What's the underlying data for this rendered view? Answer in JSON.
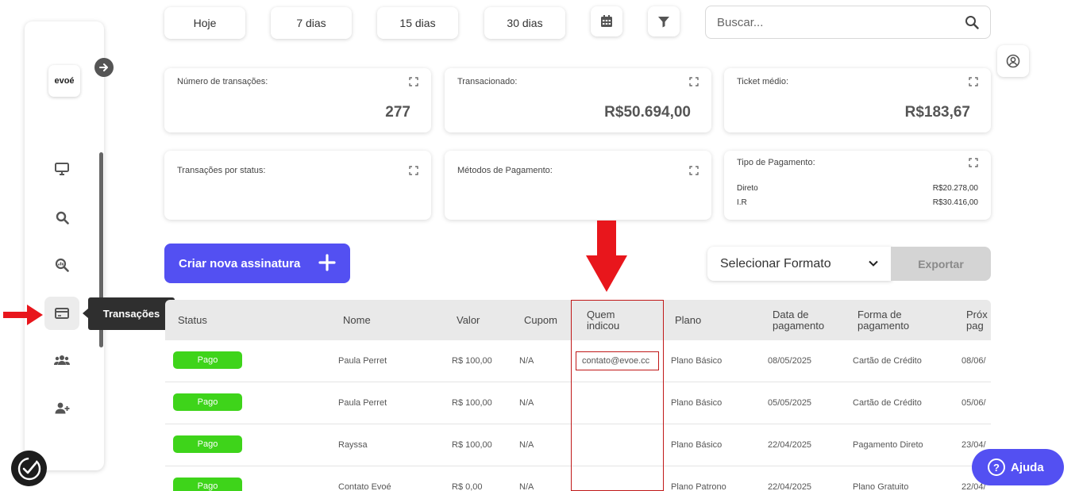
{
  "sidebar": {
    "logo": "evoé",
    "tooltip": "Transações",
    "nav_icons": [
      "monitor-icon",
      "search-icon",
      "analytics-icon",
      "card-icon",
      "users-icon",
      "user-add-icon"
    ]
  },
  "filters": {
    "periods": [
      "Hoje",
      "7 dias",
      "15 dias",
      "30 dias"
    ],
    "search_placeholder": "Buscar..."
  },
  "cards": {
    "num_transactions": {
      "title": "Número de transações:",
      "value": "277"
    },
    "transacted": {
      "title": "Transacionado:",
      "value": "R$50.694,00"
    },
    "ticket": {
      "title": "Ticket médio:",
      "value": "R$183,67"
    },
    "by_status": {
      "title": "Transações por status:"
    },
    "payment_methods": {
      "title": "Métodos de Pagamento:"
    },
    "payment_type": {
      "title": "Tipo de Pagamento:",
      "rows": [
        {
          "label": "Direto",
          "value": "R$20.278,00"
        },
        {
          "label": "I.R",
          "value": "R$30.416,00"
        }
      ]
    }
  },
  "actions": {
    "create_label": "Criar nova assinatura",
    "format_label": "Selecionar Formato",
    "export_label": "Exportar"
  },
  "table": {
    "headers": {
      "status": "Status",
      "nome": "Nome",
      "valor": "Valor",
      "cupom": "Cupom",
      "quem_1": "Quem",
      "quem_2": "indicou",
      "plano": "Plano",
      "data_1": "Data de",
      "data_2": "pagamento",
      "forma_1": "Forma de",
      "forma_2": "pagamento",
      "prox_1": "Próx",
      "prox_2": "pag"
    },
    "rows": [
      {
        "status": "Pago",
        "nome": "Paula Perret",
        "valor": "R$ 100,00",
        "cupom": "N/A",
        "quem": "contato@evoe.cc",
        "plano": "Plano Básico",
        "data": "08/05/2025",
        "forma": "Cartão de Crédito",
        "prox": "08/06/"
      },
      {
        "status": "Pago",
        "nome": "Paula Perret",
        "valor": "R$ 100,00",
        "cupom": "N/A",
        "quem": "",
        "plano": "Plano Básico",
        "data": "05/05/2025",
        "forma": "Cartão de Crédito",
        "prox": "05/06/"
      },
      {
        "status": "Pago",
        "nome": "Rayssa",
        "valor": "R$ 100,00",
        "cupom": "N/A",
        "quem": "",
        "plano": "Plano Básico",
        "data": "22/04/2025",
        "forma": "Pagamento Direto",
        "prox": "23/04/"
      },
      {
        "status": "Pago",
        "nome": "Contato Evoé",
        "valor": "R$ 0,00",
        "cupom": "N/A",
        "quem": "",
        "plano": "Plano Patrono",
        "data": "22/04/2025",
        "forma": "Plano Gratuito",
        "prox": "22/04/"
      }
    ]
  },
  "help": {
    "label": "Ajuda",
    "icon": "?"
  },
  "colors": {
    "primary": "#5350f2",
    "paid": "#3ed41a",
    "annotation": "#e8161c"
  }
}
